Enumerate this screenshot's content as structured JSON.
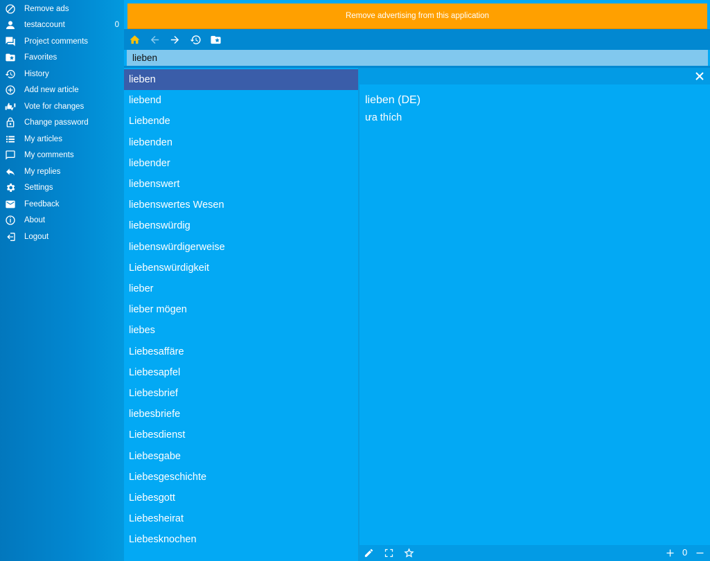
{
  "sidebar": {
    "items": [
      {
        "label": "Remove ads",
        "icon": "block-icon"
      },
      {
        "label": "testaccount",
        "icon": "person-icon",
        "count": "0"
      },
      {
        "label": "Project comments",
        "icon": "comments-icon"
      },
      {
        "label": "Favorites",
        "icon": "star-folder-icon"
      },
      {
        "label": "History",
        "icon": "history-icon"
      },
      {
        "label": "Add new article",
        "icon": "add-circle-icon"
      },
      {
        "label": "Vote for changes",
        "icon": "thumbs-icon"
      },
      {
        "label": "Change password",
        "icon": "lock-icon"
      },
      {
        "label": "My articles",
        "icon": "list-icon"
      },
      {
        "label": "My comments",
        "icon": "comment-icon"
      },
      {
        "label": "My replies",
        "icon": "reply-icon"
      },
      {
        "label": "Settings",
        "icon": "gear-icon"
      },
      {
        "label": "Feedback",
        "icon": "mail-icon"
      },
      {
        "label": "About",
        "icon": "info-icon"
      },
      {
        "label": "Logout",
        "icon": "logout-icon"
      }
    ]
  },
  "ad_banner": {
    "text": "Remove advertising from this application"
  },
  "search": {
    "value": "lieben"
  },
  "word_list": [
    "lieben",
    "liebend",
    "Liebende",
    "liebenden",
    "liebender",
    "liebenswert",
    "liebenswertes Wesen",
    "liebenswürdig",
    "liebenswürdigerweise",
    "Liebenswürdigkeit",
    "lieber",
    "lieber mögen",
    "liebes",
    "Liebesaffäre",
    "Liebesapfel",
    "Liebesbrief",
    "liebesbriefe",
    "Liebesdienst",
    "Liebesgabe",
    "Liebesgeschichte",
    "Liebesgott",
    "Liebesheirat",
    "Liebesknochen"
  ],
  "selected_index": 0,
  "detail": {
    "title": "lieben (DE)",
    "translation": "ưa thích",
    "zoom": "0"
  },
  "colors": {
    "sidebar": "#0288d1",
    "banner": "#ffa000",
    "home_icon": "#ffc107",
    "selected_row": "#3a5da9",
    "content": "#03a9f4"
  }
}
